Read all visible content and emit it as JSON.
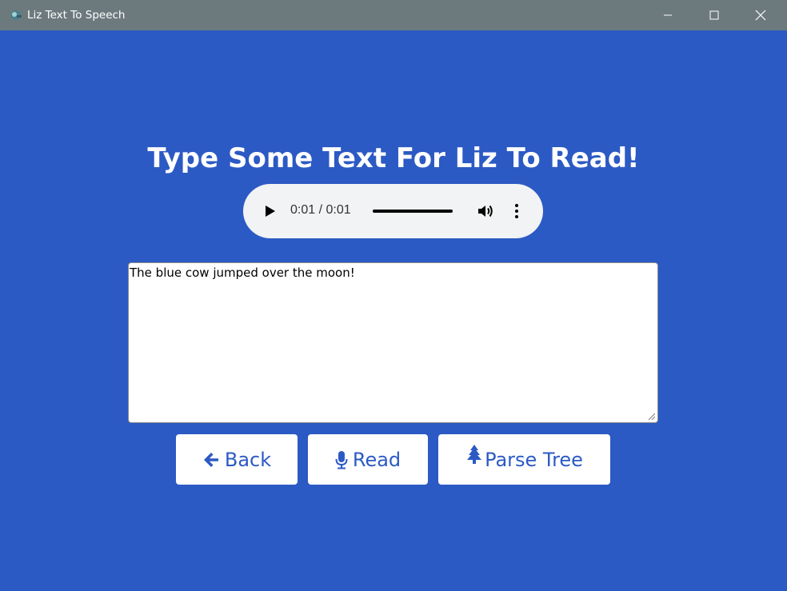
{
  "window": {
    "title": "Liz Text To Speech",
    "controls": [
      "minimize-icon",
      "maximize-icon",
      "close-icon"
    ]
  },
  "main": {
    "heading": "Type Some Text For Liz To Read!",
    "audio": {
      "time_display": "0:01 / 0:01",
      "progress": 1.0,
      "icons": [
        "play-icon",
        "volume-icon",
        "more-vert-icon"
      ]
    },
    "text_input": {
      "value": "The blue cow jumped over the moon!"
    },
    "buttons": {
      "back_label": "Back",
      "read_label": "Read",
      "parse_label": "Parse Tree"
    }
  },
  "colors": {
    "background": "#2c5ac4",
    "titlebar": "#6c7a7e",
    "button_text": "#2c5ac4",
    "player_bg": "#f1f3f4"
  }
}
